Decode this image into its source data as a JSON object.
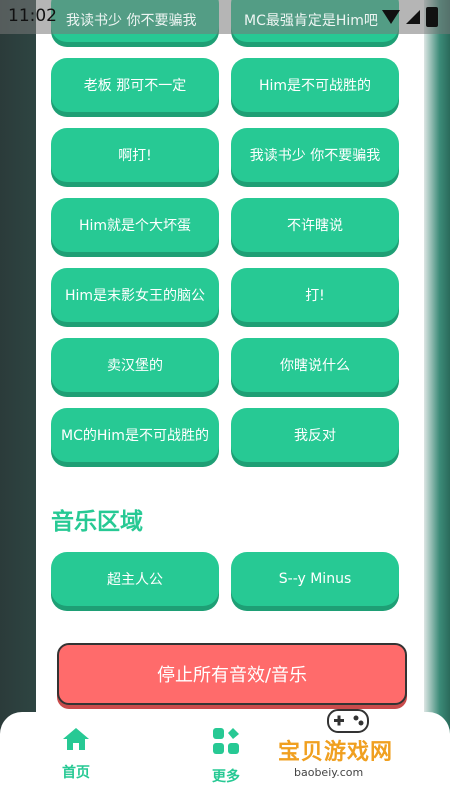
{
  "status_bar": {
    "time": "11:02",
    "ghost_left": "我读书少 你不要骗我",
    "ghost_right": "MC最强肯定是Him吧"
  },
  "sound_buttons": [
    [
      "老板 那可不一定",
      "Him是不可战胜的"
    ],
    [
      "啊打!",
      "我读书少 你不要骗我"
    ],
    [
      "Him就是个大坏蛋",
      "不许瞎说"
    ],
    [
      "Him是末影女王的脑公",
      "打!"
    ],
    [
      "卖汉堡的",
      "你瞎说什么"
    ],
    [
      "MC的Him是不可战胜的",
      "我反对"
    ]
  ],
  "music_section": {
    "title": "音乐区域",
    "buttons": [
      "超主人公",
      "S--y Minus"
    ]
  },
  "stop_button": {
    "label": "停止所有音效/音乐",
    "color": "#ff6b6b"
  },
  "bottom_nav": {
    "home_label": "首页",
    "more_label": "更多"
  },
  "watermark": {
    "title": "宝贝游戏网",
    "url": "baobeiy.com"
  },
  "colors": {
    "accent": "#27c994",
    "accent_shadow": "#1e9f75"
  }
}
